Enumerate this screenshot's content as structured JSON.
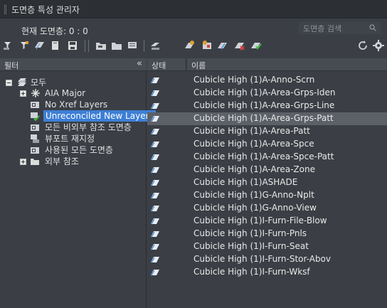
{
  "window": {
    "title": "도면층 특성 관리자"
  },
  "current_layer": "현재 도면층: 0 : 0",
  "search": {
    "placeholder": "도면층 검색"
  },
  "toolbar": {
    "left_icons": [
      "new-property-filter-icon",
      "new-group-filter-icon",
      "layer-states-icon",
      "new-layer-icon",
      "save-icon"
    ],
    "mid_icons": [
      "new-layer-vp-frozen-icon",
      "delete-layer-icon",
      "set-current-icon",
      "layer-settings-icon"
    ],
    "right_icons": [
      "refresh-icon",
      "settings-gear-icon"
    ]
  },
  "filter_pane": {
    "header": "필터",
    "collapse": "«",
    "tree": [
      {
        "label": "모두",
        "icon": "all-layers-icon",
        "expander": "minus",
        "level": 0
      },
      {
        "label": "AIA Major",
        "icon": "property-filter-icon",
        "expander": "plus",
        "level": 1
      },
      {
        "label": "No Xref Layers",
        "icon": "group-filter-icon",
        "expander": "",
        "level": 1
      },
      {
        "label": "Unreconciled New Layers",
        "icon": "unreconciled-filter-icon",
        "expander": "",
        "level": 1,
        "selected": true
      },
      {
        "label": "모든 비외부 참조 도면층",
        "icon": "group-filter-icon",
        "expander": "",
        "level": 1
      },
      {
        "label": "뷰포트 재지정",
        "icon": "viewport-override-icon",
        "expander": "",
        "level": 1
      },
      {
        "label": "사용된 모든 도면층",
        "icon": "group-filter-icon",
        "expander": "",
        "level": 1
      },
      {
        "label": "외부 참조",
        "icon": "xref-folder-icon",
        "expander": "plus",
        "level": 1
      }
    ]
  },
  "layer_list": {
    "columns": {
      "status": "상태",
      "name": "이름"
    },
    "highlighted_index": 3,
    "rows": [
      "Cubicle High (1)A-Anno-Scrn",
      "Cubicle High (1)A-Area-Grps-Iden",
      "Cubicle High (1)A-Area-Grps-Line",
      "Cubicle High (1)A-Area-Grps-Patt",
      "Cubicle High (1)A-Area-Patt",
      "Cubicle High (1)A-Area-Spce",
      "Cubicle High (1)A-Area-Spce-Patt",
      "Cubicle High (1)A-Area-Zone",
      "Cubicle High (1)ASHADE",
      "Cubicle High (1)G-Anno-Nplt",
      "Cubicle High (1)G-Anno-View",
      "Cubicle High (1)I-Furn-File-Blow",
      "Cubicle High (1)I-Furn-Pnls",
      "Cubicle High (1)I-Furn-Seat",
      "Cubicle High (1)I-Furn-Stor-Abov",
      "Cubicle High (1)I-Furn-Wksf"
    ]
  },
  "colors": {
    "selection": "#3d7fd6",
    "row_highlight": "#5c6067",
    "layer_status_blue": "#4a8fe0"
  }
}
